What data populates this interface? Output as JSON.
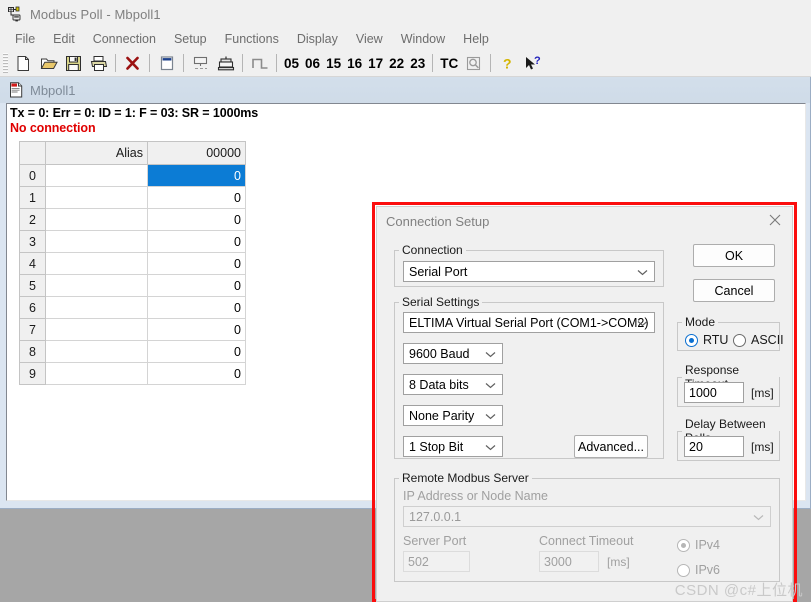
{
  "window": {
    "title": "Modbus Poll - Mbpoll1",
    "icon": "modbus-app-icon"
  },
  "menubar": {
    "items": [
      {
        "label": "File"
      },
      {
        "label": "Edit"
      },
      {
        "label": "Connection"
      },
      {
        "label": "Setup"
      },
      {
        "label": "Functions"
      },
      {
        "label": "Display"
      },
      {
        "label": "View"
      },
      {
        "label": "Window"
      },
      {
        "label": "Help"
      }
    ]
  },
  "toolbar": {
    "icons": [
      {
        "name": "new-document-icon",
        "glyph": "new"
      },
      {
        "name": "open-folder-icon",
        "glyph": "open"
      },
      {
        "name": "save-disk-icon",
        "glyph": "save"
      },
      {
        "name": "print-icon",
        "glyph": "print"
      }
    ],
    "disconnect": {
      "name": "disconnect-x-icon",
      "glyph": "x"
    },
    "window_icon": {
      "name": "window-icon",
      "glyph": "win"
    },
    "poll_icons": [
      {
        "name": "read-write-definition-icon",
        "glyph": "rw"
      },
      {
        "name": "modbus-device-icon",
        "glyph": "dev"
      }
    ],
    "pulse_icon": {
      "name": "pulse-signal-icon",
      "glyph": "pulse"
    },
    "function_codes": [
      "05",
      "06",
      "15",
      "16",
      "17",
      "22",
      "23"
    ],
    "tc_label": "TC",
    "tc_icon": {
      "name": "tc-magnifier-icon"
    },
    "help_icon": {
      "name": "help-question-icon"
    },
    "context_help_icon": {
      "name": "context-help-arrow-icon"
    }
  },
  "mdi_child": {
    "title": "Mbpoll1",
    "icon": "document-icon",
    "status_line": "Tx = 0: Err = 0: ID = 1: F = 03: SR = 1000ms",
    "connection_status": "No connection"
  },
  "grid": {
    "headers": [
      "",
      "Alias",
      "00000"
    ],
    "rows": [
      {
        "index": "0",
        "alias": "",
        "value": "0",
        "selected": true
      },
      {
        "index": "1",
        "alias": "",
        "value": "0",
        "selected": false
      },
      {
        "index": "2",
        "alias": "",
        "value": "0",
        "selected": false
      },
      {
        "index": "3",
        "alias": "",
        "value": "0",
        "selected": false
      },
      {
        "index": "4",
        "alias": "",
        "value": "0",
        "selected": false
      },
      {
        "index": "5",
        "alias": "",
        "value": "0",
        "selected": false
      },
      {
        "index": "6",
        "alias": "",
        "value": "0",
        "selected": false
      },
      {
        "index": "7",
        "alias": "",
        "value": "0",
        "selected": false
      },
      {
        "index": "8",
        "alias": "",
        "value": "0",
        "selected": false
      },
      {
        "index": "9",
        "alias": "",
        "value": "0",
        "selected": false
      }
    ]
  },
  "dialog": {
    "title": "Connection Setup",
    "close_icon": "close-icon",
    "ok_label": "OK",
    "cancel_label": "Cancel",
    "connection_group": {
      "legend": "Connection",
      "selected": "Serial Port"
    },
    "serial_settings": {
      "legend": "Serial Settings",
      "port": "ELTIMA Virtual Serial Port (COM1->COM2)",
      "baud": "9600 Baud",
      "data_bits": "8 Data bits",
      "parity": "None Parity",
      "stop_bits": "1 Stop Bit",
      "advanced_label": "Advanced..."
    },
    "mode": {
      "legend": "Mode",
      "rtu_label": "RTU",
      "ascii_label": "ASCII",
      "selected": "RTU"
    },
    "response_timeout": {
      "legend": "Response Timeout",
      "value": "1000",
      "unit": "[ms]"
    },
    "delay_between_polls": {
      "legend": "Delay Between Polls",
      "value": "20",
      "unit": "[ms]"
    },
    "remote_server": {
      "legend": "Remote Modbus Server",
      "ip_label": "IP Address or Node Name",
      "ip_value": "127.0.0.1",
      "server_port_label": "Server Port",
      "server_port_value": "502",
      "connect_timeout_label": "Connect Timeout",
      "connect_timeout_value": "3000",
      "connect_timeout_unit": "[ms]",
      "ipv4_label": "IPv4",
      "ipv6_label": "IPv6",
      "ip_version_selected": "IPv4"
    }
  },
  "watermark": "CSDN @c#上位机",
  "colors": {
    "accent_selection": "#0c7cd5",
    "error_text": "#e00000",
    "highlight_border": "#fb0d0d",
    "radio_accent": "#0a6fd1"
  }
}
